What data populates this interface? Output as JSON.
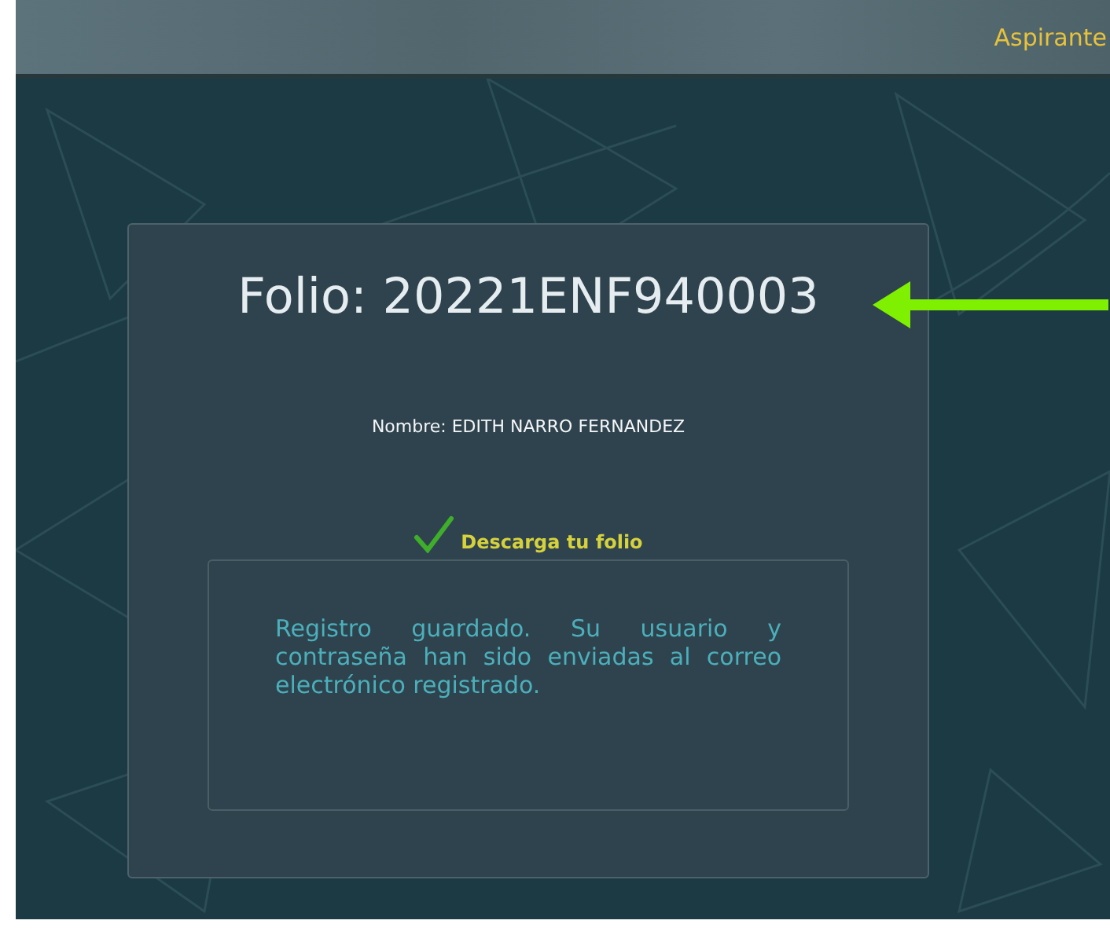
{
  "header": {
    "link": "Aspirante"
  },
  "card": {
    "title": "Folio: 20221ENF940003",
    "name_line": "Nombre: EDITH NARRO FERNANDEZ",
    "download_link": "Descarga tu folio",
    "message": "Registro guardado. Su usuario y contraseña han sido enviadas al correo electrónico registrado."
  }
}
